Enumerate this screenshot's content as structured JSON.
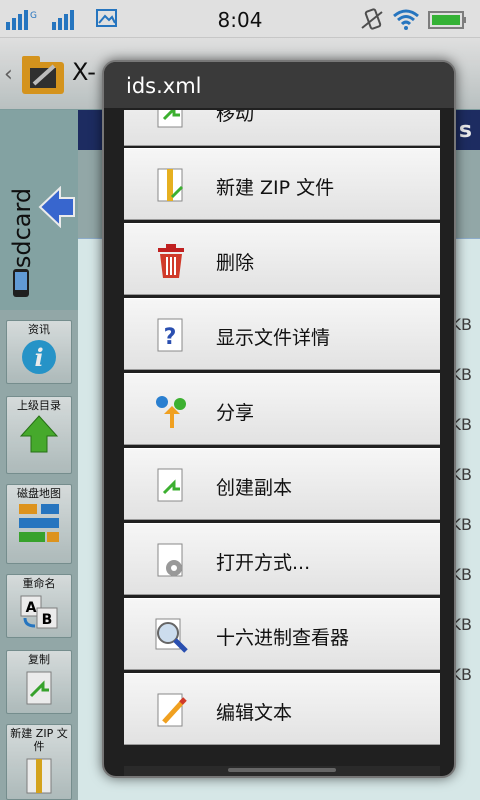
{
  "status": {
    "time": "8:04"
  },
  "app": {
    "title": "X-"
  },
  "sidebar": {
    "tab_label": "sdcard"
  },
  "toolbar": [
    {
      "label": "资讯",
      "icon": "info-icon"
    },
    {
      "label": "上级目录",
      "icon": "up-arrow-icon"
    },
    {
      "label": "磁盘地图",
      "icon": "disk-map-icon"
    },
    {
      "label": "重命名",
      "icon": "rename-icon"
    },
    {
      "label": "复制",
      "icon": "copy-icon"
    },
    {
      "label": "新建 ZIP 文件",
      "icon": "zip-icon"
    }
  ],
  "background": {
    "band_text": "s",
    "sizes": [
      "KB",
      "KB",
      "KB",
      "KB",
      "KB",
      "KB",
      "KB",
      "KB"
    ]
  },
  "dialog": {
    "title": "ids.xml",
    "items": [
      {
        "label": "移动",
        "icon": "move-icon"
      },
      {
        "label": "新建 ZIP 文件",
        "icon": "zip-file-icon"
      },
      {
        "label": "删除",
        "icon": "trash-icon"
      },
      {
        "label": "显示文件详情",
        "icon": "file-details-icon"
      },
      {
        "label": "分享",
        "icon": "share-icon"
      },
      {
        "label": "创建副本",
        "icon": "duplicate-icon"
      },
      {
        "label": "打开方式...",
        "icon": "open-with-icon"
      },
      {
        "label": "十六进制查看器",
        "icon": "hex-viewer-icon"
      },
      {
        "label": "编辑文本",
        "icon": "edit-text-icon"
      }
    ]
  },
  "colors": {
    "accent": "#2a7fd0",
    "dialog_bg": "#202020",
    "item_bg": "#f0f0f0"
  }
}
